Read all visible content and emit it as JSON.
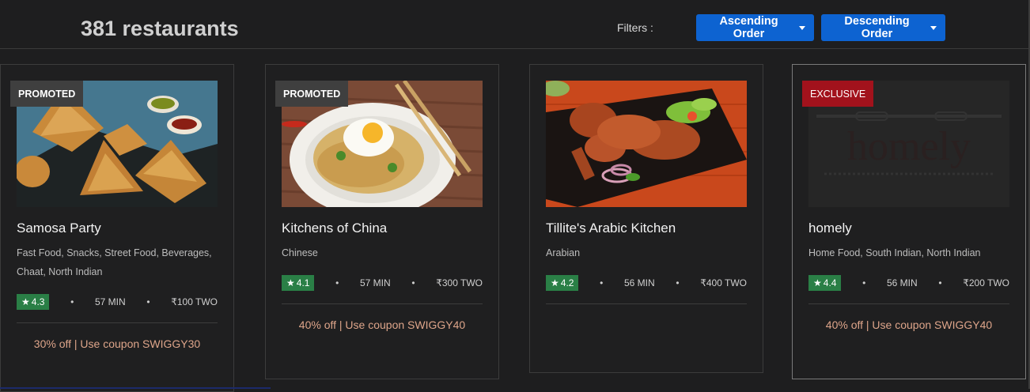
{
  "header": {
    "count_title": "381 restaurants",
    "filters_label": "Filters :",
    "ascending_label": "Ascending Order",
    "descending_label": "Descending Order"
  },
  "colors": {
    "primary_button": "#0d63d1",
    "rating_green": "#2a7f46",
    "exclusive_red": "#a2121c",
    "offer_text": "#dea58a"
  },
  "restaurants": [
    {
      "badge": "PROMOTED",
      "name": "Samosa Party",
      "cuisines": "Fast Food, Snacks, Street Food, Beverages, Chaat, North Indian",
      "rating": "4.3",
      "time": "57 MIN",
      "cost": "₹100 TWO",
      "offer": "30% off | Use coupon SWIGGY30",
      "image_icon": "samosa-photo"
    },
    {
      "badge": "PROMOTED",
      "name": "Kitchens of China",
      "cuisines": "Chinese",
      "rating": "4.1",
      "time": "57 MIN",
      "cost": "₹300 TWO",
      "offer": "40% off | Use coupon SWIGGY40",
      "image_icon": "noodles-photo"
    },
    {
      "badge": "",
      "name": "Tillite's Arabic Kitchen",
      "cuisines": "Arabian",
      "rating": "4.2",
      "time": "56 MIN",
      "cost": "₹400 TWO",
      "offer": "",
      "image_icon": "grilled-chicken-photo"
    },
    {
      "badge": "EXCLUSIVE",
      "name": "homely",
      "cuisines": "Home Food, South Indian, North Indian",
      "rating": "4.4",
      "time": "56 MIN",
      "cost": "₹200 TWO",
      "offer": "40% off | Use coupon SWIGGY40",
      "image_icon": "homely-logo",
      "logo_text": "homely"
    }
  ]
}
